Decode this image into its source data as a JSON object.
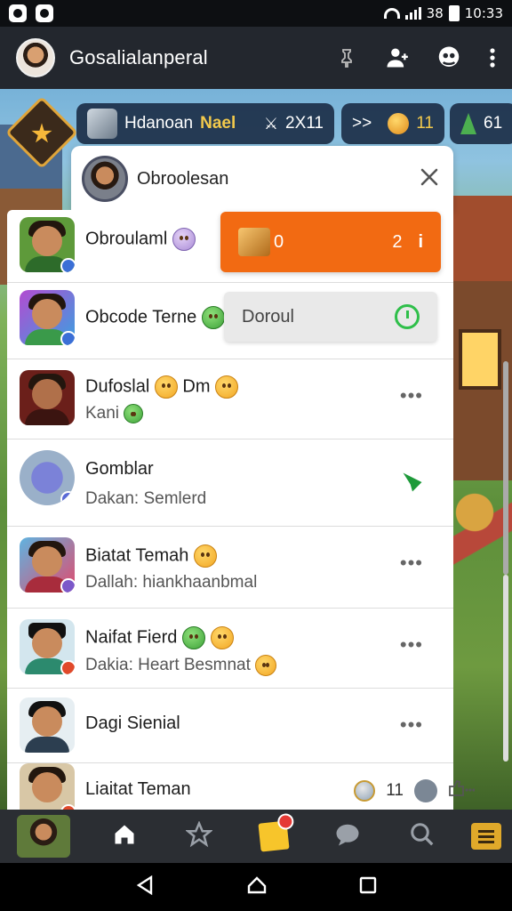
{
  "status_bar": {
    "time": "10:33",
    "battery": "38"
  },
  "app_bar": {
    "title": "Gosalialanperal"
  },
  "hud": {
    "pill1_text_a": "Hdanoan",
    "pill1_text_b": "Nael",
    "pill1_value": "2X11",
    "pill2_prefix": ">>",
    "pill2_value": "11",
    "pill3_value": "61"
  },
  "panel": {
    "title": "Obroolesan"
  },
  "bubbles": {
    "orange_left": "0",
    "orange_right": "2",
    "grey_label": "Doroul"
  },
  "chats": [
    {
      "name": "Obroulaml",
      "sub": ""
    },
    {
      "name": "Obcode Terne",
      "sub": ""
    },
    {
      "name": "Dufoslal",
      "name_suffix": "Dm",
      "sub": "Kani"
    },
    {
      "name": "Gomblar",
      "sub": "Dakan: Semlerd"
    },
    {
      "name": "Biatat Temah",
      "sub": "Dallah: hiankhaanbmal"
    },
    {
      "name": "Naifat Fierd",
      "sub": "Dakia: Heart Besmnat"
    },
    {
      "name": "Dagi Sienial",
      "sub": ""
    },
    {
      "name": "Liaitat Teman",
      "sub": "",
      "count": "11"
    }
  ],
  "icons": {
    "appbar": [
      "pin-icon",
      "add-user-icon",
      "people-icon",
      "more-vert-icon"
    ],
    "bottom_nav": [
      "home-icon",
      "star-icon",
      "note-icon",
      "chat-icon",
      "search-icon",
      "menu-icon"
    ]
  },
  "colors": {
    "accent_orange": "#f26a12",
    "online_green": "#2fbf4a",
    "appbar": "#23272e"
  }
}
